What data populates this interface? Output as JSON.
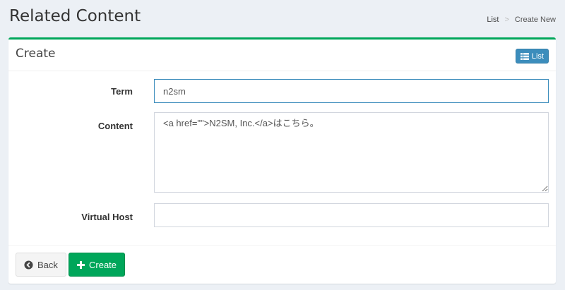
{
  "header": {
    "title": "Related Content",
    "breadcrumb": [
      {
        "label": "List"
      },
      {
        "label": "Create New"
      }
    ],
    "breadcrumb_separator": ">"
  },
  "box": {
    "title": "Create",
    "list_button_label": "List",
    "list_button_icon": "list-icon",
    "accent_color": "#00a65a"
  },
  "form": {
    "term": {
      "label": "Term",
      "value": "n2sm"
    },
    "content": {
      "label": "Content",
      "value": "<a href=\"\">N2SM, Inc.</a>はこちら。"
    },
    "virtual_host": {
      "label": "Virtual Host",
      "value": ""
    }
  },
  "footer": {
    "back_label": "Back",
    "back_icon": "arrow-circle-left-icon",
    "create_label": "Create",
    "create_icon": "plus-icon"
  }
}
